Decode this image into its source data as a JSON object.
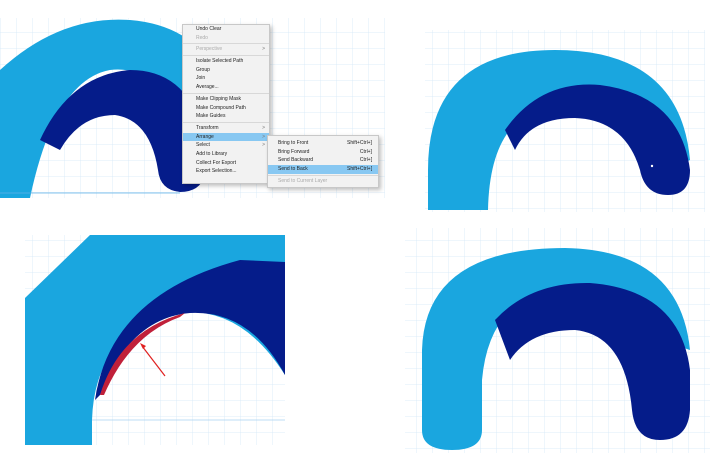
{
  "context_menu": {
    "items": [
      {
        "label": "Undo Clear",
        "disabled": false
      },
      {
        "label": "Redo",
        "disabled": true
      },
      {
        "label": "Perspective",
        "disabled": true,
        "submenu": true
      },
      {
        "label": "Isolate Selected Path",
        "disabled": false
      },
      {
        "label": "Group",
        "disabled": false
      },
      {
        "label": "Join",
        "disabled": false
      },
      {
        "label": "Average...",
        "disabled": false
      },
      {
        "label": "Make Clipping Mask",
        "disabled": false
      },
      {
        "label": "Make Compound Path",
        "disabled": false
      },
      {
        "label": "Make Guides",
        "disabled": false
      },
      {
        "label": "Transform",
        "disabled": false,
        "submenu": true
      },
      {
        "label": "Arrange",
        "disabled": false,
        "submenu": true,
        "highlighted": true
      },
      {
        "label": "Select",
        "disabled": false,
        "submenu": true
      },
      {
        "label": "Add to Library",
        "disabled": false
      },
      {
        "label": "Collect For Export",
        "disabled": false
      },
      {
        "label": "Export Selection...",
        "disabled": false
      }
    ],
    "submenu_arrow": ">"
  },
  "arrange_submenu": {
    "items": [
      {
        "label": "Bring to Front",
        "shortcut": "Shift+Ctrl+]"
      },
      {
        "label": "Bring Forward",
        "shortcut": "Ctrl+]"
      },
      {
        "label": "Send Backward",
        "shortcut": "Ctrl+["
      },
      {
        "label": "Send to Back",
        "shortcut": "Shift+Ctrl+[",
        "highlighted": true
      },
      {
        "label": "Send to Current Layer",
        "shortcut": "",
        "disabled": true
      }
    ]
  },
  "colors": {
    "light_blue": "#1aa6df",
    "dark_blue": "#051c8a",
    "grid": "#cfe6f6",
    "highlight": "#88c8f2",
    "arrow": "#e02020"
  }
}
